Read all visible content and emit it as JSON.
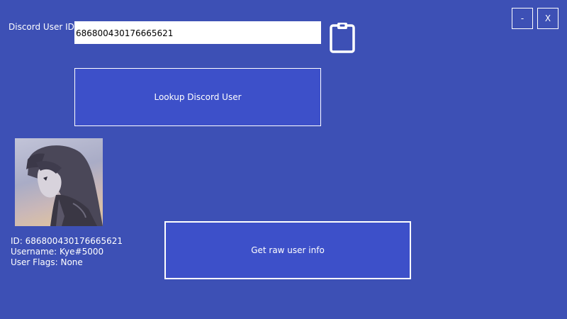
{
  "form": {
    "user_id_label": "Discord User ID:",
    "user_id_value": "686800430176665621"
  },
  "window_controls": {
    "minimize_label": "-",
    "close_label": "X"
  },
  "buttons": {
    "lookup_label": "Lookup Discord User",
    "raw_info_label": "Get raw user info"
  },
  "user_info": {
    "id_line": "ID: 686800430176665621",
    "username_line": "Username: Kye#5000",
    "flags_line": "User Flags: None"
  },
  "icons": {
    "paste": "clipboard-icon",
    "avatar": "user-avatar-image"
  },
  "colors": {
    "background": "#3d50b5",
    "button_fill": "#3d50c9",
    "foreground": "#ffffff"
  }
}
